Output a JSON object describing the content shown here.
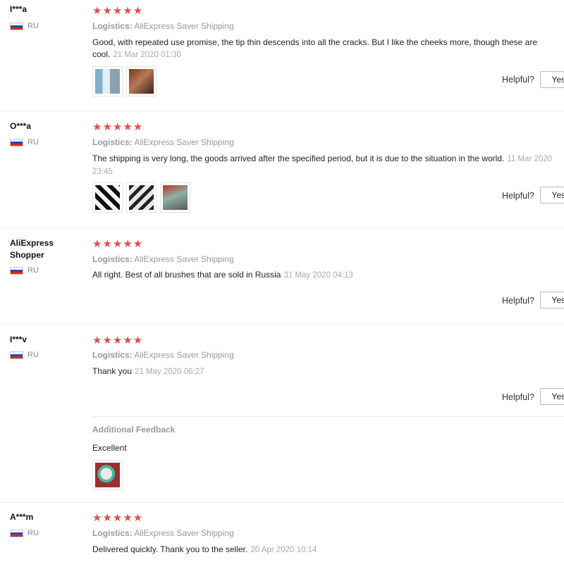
{
  "reviews": [
    {
      "user": "I***a",
      "country": "RU",
      "stars": "★★★★★",
      "logistics_label": "Logistics:",
      "logistics_value": "AliExpress Saver Shipping",
      "text": "Good, with repeated use promise, the tip thin descends into all the cracks. But I like the cheeks more, though these are cool.",
      "date": "21 Mar 2020 01:30",
      "helpful_label": "Helpful?",
      "yes_label": "Yes (",
      "photos": [
        "img-a",
        "img-b"
      ]
    },
    {
      "user": "O***a",
      "country": "RU",
      "stars": "★★★★★",
      "logistics_label": "Logistics:",
      "logistics_value": "AliExpress Saver Shipping",
      "text": "The shipping is very long, the goods arrived after the specified period, but it is due to the situation in the world.",
      "date": "11 Mar 2020 23:45",
      "helpful_label": "Helpful?",
      "yes_label": "Yes (",
      "photos": [
        "img-c",
        "img-d",
        "img-e"
      ]
    },
    {
      "user": "AliExpress Shopper",
      "country": "RU",
      "stars": "★★★★★",
      "logistics_label": "Logistics:",
      "logistics_value": "AliExpress Saver Shipping",
      "text": "All right. Best of all brushes that are sold in Russia",
      "date": "31 May 2020 04:13",
      "helpful_label": "Helpful?",
      "yes_label": "Yes ("
    },
    {
      "user": "I***v",
      "country": "RU",
      "stars": "★★★★★",
      "logistics_label": "Logistics:",
      "logistics_value": "AliExpress Saver Shipping",
      "text": "Thank you",
      "date": "21 May 2020 06:27",
      "helpful_label": "Helpful?",
      "yes_label": "Yes (",
      "additional_title": "Additional Feedback",
      "additional_text": "Excellent",
      "additional_photos": [
        "img-f"
      ]
    },
    {
      "user": "A***m",
      "country": "RU",
      "stars": "★★★★★",
      "logistics_label": "Logistics:",
      "logistics_value": "AliExpress Saver Shipping",
      "text": "Delivered quickly. Thank you to the seller.",
      "date": "20 Apr 2020 10:14"
    }
  ],
  "colors": {
    "star": "#e54b4b",
    "muted": "#999999",
    "date": "#aaaaaa",
    "separator": "#ececec"
  }
}
